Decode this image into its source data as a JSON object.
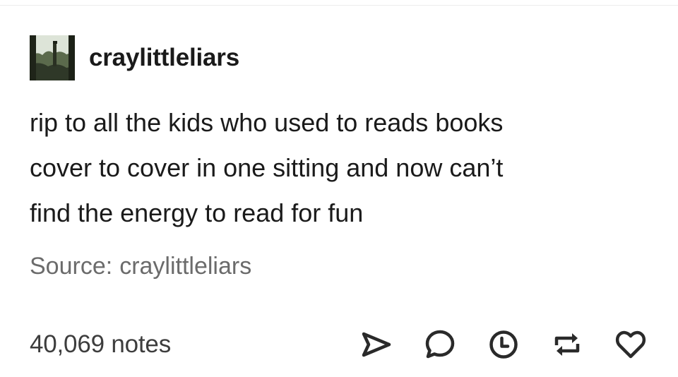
{
  "post": {
    "username": "craylittleliars",
    "body_lines": [
      "rip to all the kids who used to reads books",
      "cover to cover in one sitting and now can’t",
      "find the energy to read for fun"
    ],
    "source_label": "Source:",
    "source_name": "craylittleliars",
    "notes": "40,069 notes"
  },
  "actions": [
    {
      "name": "share",
      "icon": "share-icon"
    },
    {
      "name": "reply",
      "icon": "reply-icon"
    },
    {
      "name": "queue",
      "icon": "clock-icon"
    },
    {
      "name": "reblog",
      "icon": "reblog-icon"
    },
    {
      "name": "like",
      "icon": "heart-icon"
    }
  ],
  "colors": {
    "text": "#1a1a1a",
    "muted": "#6b6b6b",
    "notes": "#3d3d3d",
    "icon": "#2a2a2a"
  }
}
